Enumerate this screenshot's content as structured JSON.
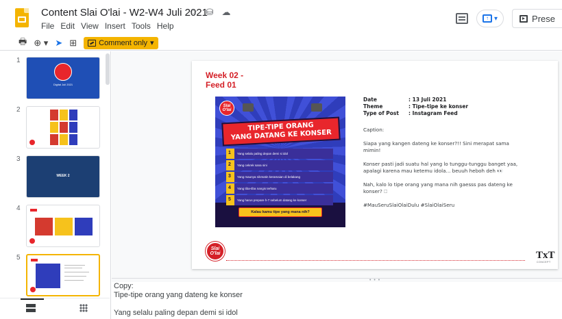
{
  "doc": {
    "title": "Content Slai O'lai - W2-W4 Juli 2021",
    "menu": [
      "File",
      "Edit",
      "View",
      "Insert",
      "Tools",
      "Help"
    ],
    "present_label": "Prese"
  },
  "toolbar": {
    "print_icon": "print-icon",
    "zoom_icon": "zoom-icon",
    "comment_only_label": "Comment only"
  },
  "thumbnails": [
    {
      "number": "1",
      "wordmark": "Slai O'lai",
      "subtitle": "Digital Juli 2021"
    },
    {
      "number": "2"
    },
    {
      "number": "3",
      "label": "WEEK 2"
    },
    {
      "number": "4"
    },
    {
      "number": "5"
    }
  ],
  "slide": {
    "heading": "Week 02 - Feed 01",
    "poster": {
      "title_line1": "TIPE-TIPE ORANG",
      "title_line2": "YANG DATANG KE KONSER",
      "items": [
        "Yang selalu paling depan demi si idol",
        "Yang cekrek sana sini",
        "Yang maunya nikmatin keramaian di belakang",
        "Yang tiba-tiba nangis terharu",
        "Yang harus prepare h-7 sebelum datang ke konser"
      ],
      "banner": "Kalau kamu tipe yang mana nih?",
      "logo": "Slai O'lai"
    },
    "info": [
      {
        "key": "Date",
        "value": ": 13 Juli 2021"
      },
      {
        "key": "Theme",
        "value": ": Tipe-tipe ke konser"
      },
      {
        "key": "Type of Post",
        "value": ": Instagram Feed"
      }
    ],
    "caption_label": "Caption:",
    "caption": [
      "Siapa yang kangen dateng ke konser?!! Sini merapat sama mimin!",
      "Konser pasti jadi suatu hal yang lo tunggu-tunggu banget yaa, apalagi karena mau ketemu idola... beuuh heboh deh 👀",
      "Nah, kalo lo tipe orang yang mana nih gaesss pas dateng ke konser? 🗆",
      "#MauSeruSlaiOlaiDulu #SlaiOlaiSeru"
    ],
    "logo": "Slai O'lai",
    "brand": "TxT",
    "brand_sub": "CONCEPT"
  },
  "notes": {
    "label": "Copy:",
    "line1": "Tipe-tipe orang yang dateng ke konser",
    "line2": "Yang selalu paling depan demi si idol"
  },
  "colors": {
    "accent": "#f4b400",
    "brand_red": "#d42027",
    "poster_blue": "#2f3dbb"
  }
}
